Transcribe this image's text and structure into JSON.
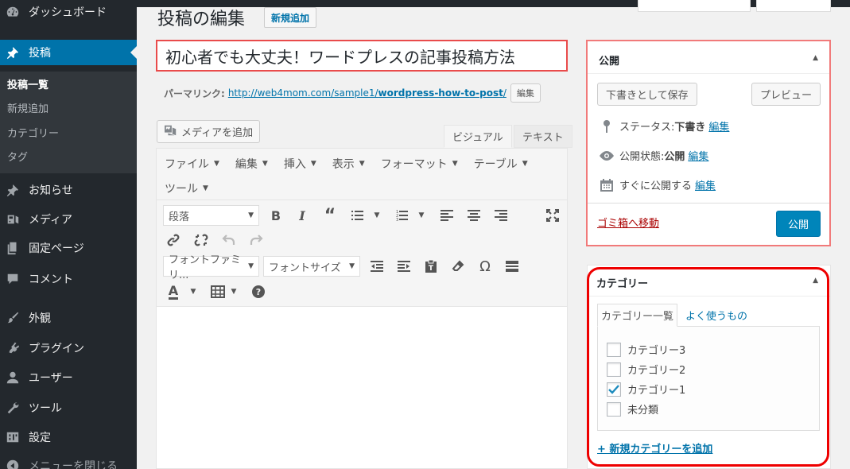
{
  "sidebar": {
    "items": [
      {
        "label": "ダッシュボード",
        "icon": "dashboard-icon"
      },
      {
        "label": "投稿",
        "icon": "pin-icon"
      },
      {
        "label": "お知らせ",
        "icon": "pin-icon"
      },
      {
        "label": "メディア",
        "icon": "media-icon"
      },
      {
        "label": "固定ページ",
        "icon": "pages-icon"
      },
      {
        "label": "コメント",
        "icon": "comment-icon"
      },
      {
        "label": "外観",
        "icon": "brush-icon"
      },
      {
        "label": "プラグイン",
        "icon": "plugin-icon"
      },
      {
        "label": "ユーザー",
        "icon": "user-icon"
      },
      {
        "label": "ツール",
        "icon": "wrench-icon"
      },
      {
        "label": "設定",
        "icon": "settings-icon"
      },
      {
        "label": "メニューを閉じる",
        "icon": "collapse-icon"
      }
    ],
    "submenu": [
      "投稿一覧",
      "新規追加",
      "カテゴリー",
      "タグ"
    ]
  },
  "header": {
    "title": "投稿の編集",
    "add_new": "新規追加"
  },
  "post": {
    "title": "初心者でも大丈夫！ワードプレスの記事投稿方法",
    "permalink_label": "パーマリンク:",
    "permalink_base": "http://web4mom.com/sample1/",
    "permalink_slug": "wordpress-how-to-post",
    "permalink_tail": "/",
    "permalink_edit": "編集"
  },
  "editor": {
    "media_button": "メディアを追加",
    "tab_visual": "ビジュアル",
    "tab_text": "テキスト",
    "menus": [
      "ファイル",
      "編集",
      "挿入",
      "表示",
      "フォーマット",
      "テーブル"
    ],
    "menu_tools": "ツール",
    "format_select": "段落",
    "font_family": "フォントファミリ...",
    "font_size": "フォントサイズ"
  },
  "publish": {
    "title": "公開",
    "save_draft": "下書きとして保存",
    "preview": "プレビュー",
    "status_label": "ステータス:",
    "status_value": "下書き",
    "visibility_label": "公開状態:",
    "visibility_value": "公開",
    "schedule_label": "すぐに公開する",
    "edit": "編集",
    "trash": "ゴミ箱へ移動",
    "publish_button": "公開"
  },
  "categories": {
    "title": "カテゴリー",
    "tab_all": "カテゴリー一覧",
    "tab_popular": "よく使うもの",
    "items": [
      {
        "label": "カテゴリー3",
        "checked": false
      },
      {
        "label": "カテゴリー2",
        "checked": false
      },
      {
        "label": "カテゴリー1",
        "checked": true
      },
      {
        "label": "未分類",
        "checked": false
      }
    ],
    "add_new": "+ 新規カテゴリーを追加"
  },
  "colors": {
    "sidebar_bg": "#23282d",
    "active_menu": "#0073aa",
    "link": "#0073aa",
    "publish_button": "#0085ba",
    "highlight_red": "#e94b4b",
    "trash": "#aa0000"
  }
}
